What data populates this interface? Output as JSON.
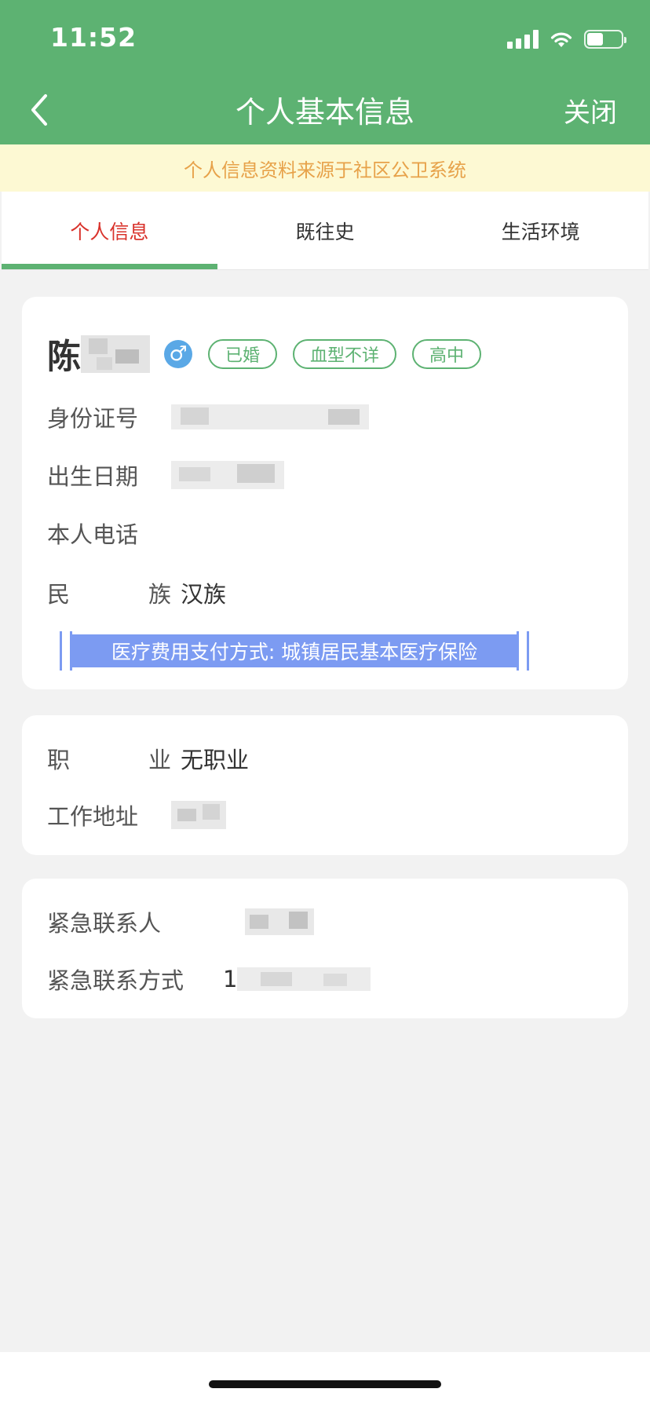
{
  "status_bar": {
    "time": "11:52"
  },
  "nav": {
    "title": "个人基本信息",
    "close_label": "关闭"
  },
  "notice": "个人信息资料来源于社区公卫系统",
  "tabs": [
    {
      "label": "个人信息",
      "active": true
    },
    {
      "label": "既往史",
      "active": false
    },
    {
      "label": "生活环境",
      "active": false
    }
  ],
  "profile": {
    "surname": "陈",
    "gender_symbol": "♂",
    "tags": [
      "已婚",
      "血型不详",
      "高中"
    ]
  },
  "basic": {
    "id_label": "身份证号",
    "birth_label": "出生日期",
    "phone_label": "本人电话",
    "ethnicity_label_chars": [
      "民",
      "族"
    ],
    "ethnicity_value": "汉族",
    "payment": "医疗费用支付方式:  城镇居民基本医疗保险"
  },
  "work": {
    "occupation_label_chars": [
      "职",
      "业"
    ],
    "occupation_value": "无职业",
    "address_label": "工作地址"
  },
  "emergency": {
    "contact_label": "紧急联系人",
    "contact_method_label": "紧急联系方式",
    "contact_method_prefix": "1"
  },
  "colors": {
    "header": "#5db272",
    "accent": "#5db272",
    "active_tab": "#d9322b",
    "notice_text": "#e7a24a",
    "notice_bg": "#fdf9d3",
    "payment_bar": "#7c9bf2"
  },
  "icons": [
    "back-arrow-icon",
    "signal-icon",
    "wifi-icon",
    "battery-icon",
    "male-icon"
  ]
}
